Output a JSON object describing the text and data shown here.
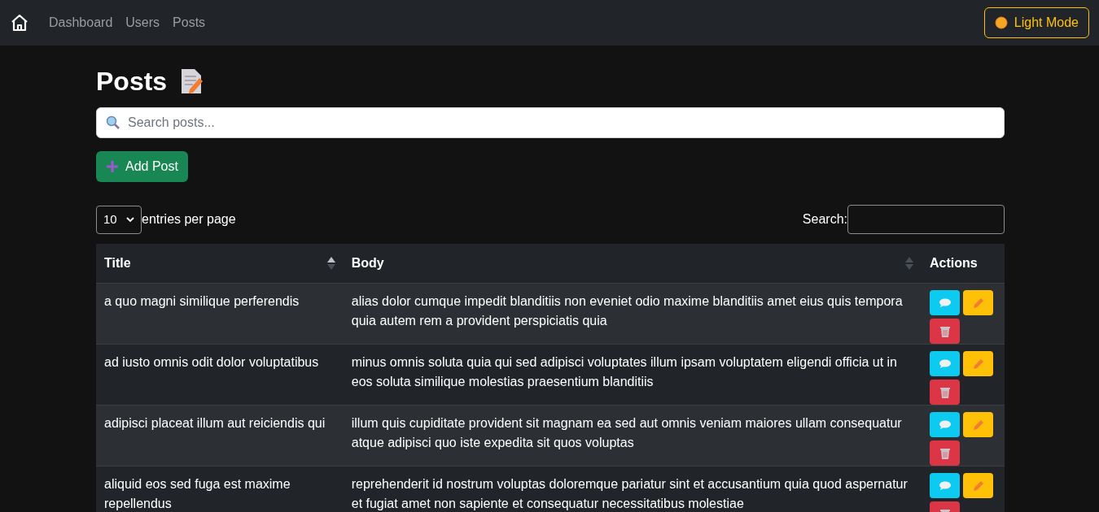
{
  "navbar": {
    "links": [
      {
        "label": "Dashboard",
        "selected": false
      },
      {
        "label": "Users",
        "selected": false
      },
      {
        "label": "Posts",
        "selected": false
      }
    ],
    "theme_button": "Light Mode"
  },
  "page_title": "Posts",
  "search": {
    "placeholder": "Search posts..."
  },
  "add_button": "Add Post",
  "table_controls": {
    "page_size": "10",
    "page_size_label": "entries per page",
    "search_label": "Search:"
  },
  "table": {
    "columns": [
      {
        "label": "Title",
        "sortable": true,
        "sorted_ascending": true
      },
      {
        "label": "Body",
        "sortable": true,
        "sorted_ascending": false
      },
      {
        "label": "Actions",
        "sortable": false
      }
    ],
    "rows": [
      {
        "title": "a quo magni similique perferendis",
        "body": "alias dolor cumque impedit blanditiis non eveniet odio maxime blanditiis amet eius quis tempora quia autem rem a provident perspiciatis quia"
      },
      {
        "title": "ad iusto omnis odit dolor voluptatibus",
        "body": "minus omnis soluta quia qui sed adipisci voluptates illum ipsam voluptatem eligendi officia ut in eos soluta similique molestias praesentium blanditiis"
      },
      {
        "title": "adipisci placeat illum aut reiciendis qui",
        "body": "illum quis cupiditate provident sit magnam ea sed aut omnis veniam maiores ullam consequatur atque adipisci quo iste expedita sit quos voluptas"
      },
      {
        "title": "aliquid eos sed fuga est maxime repellendus",
        "body": "reprehenderit id nostrum voluptas doloremque pariatur sint et accusantium quia quod aspernatur et fugiat amet non sapiente et consequatur necessitatibus molestiae"
      }
    ]
  }
}
